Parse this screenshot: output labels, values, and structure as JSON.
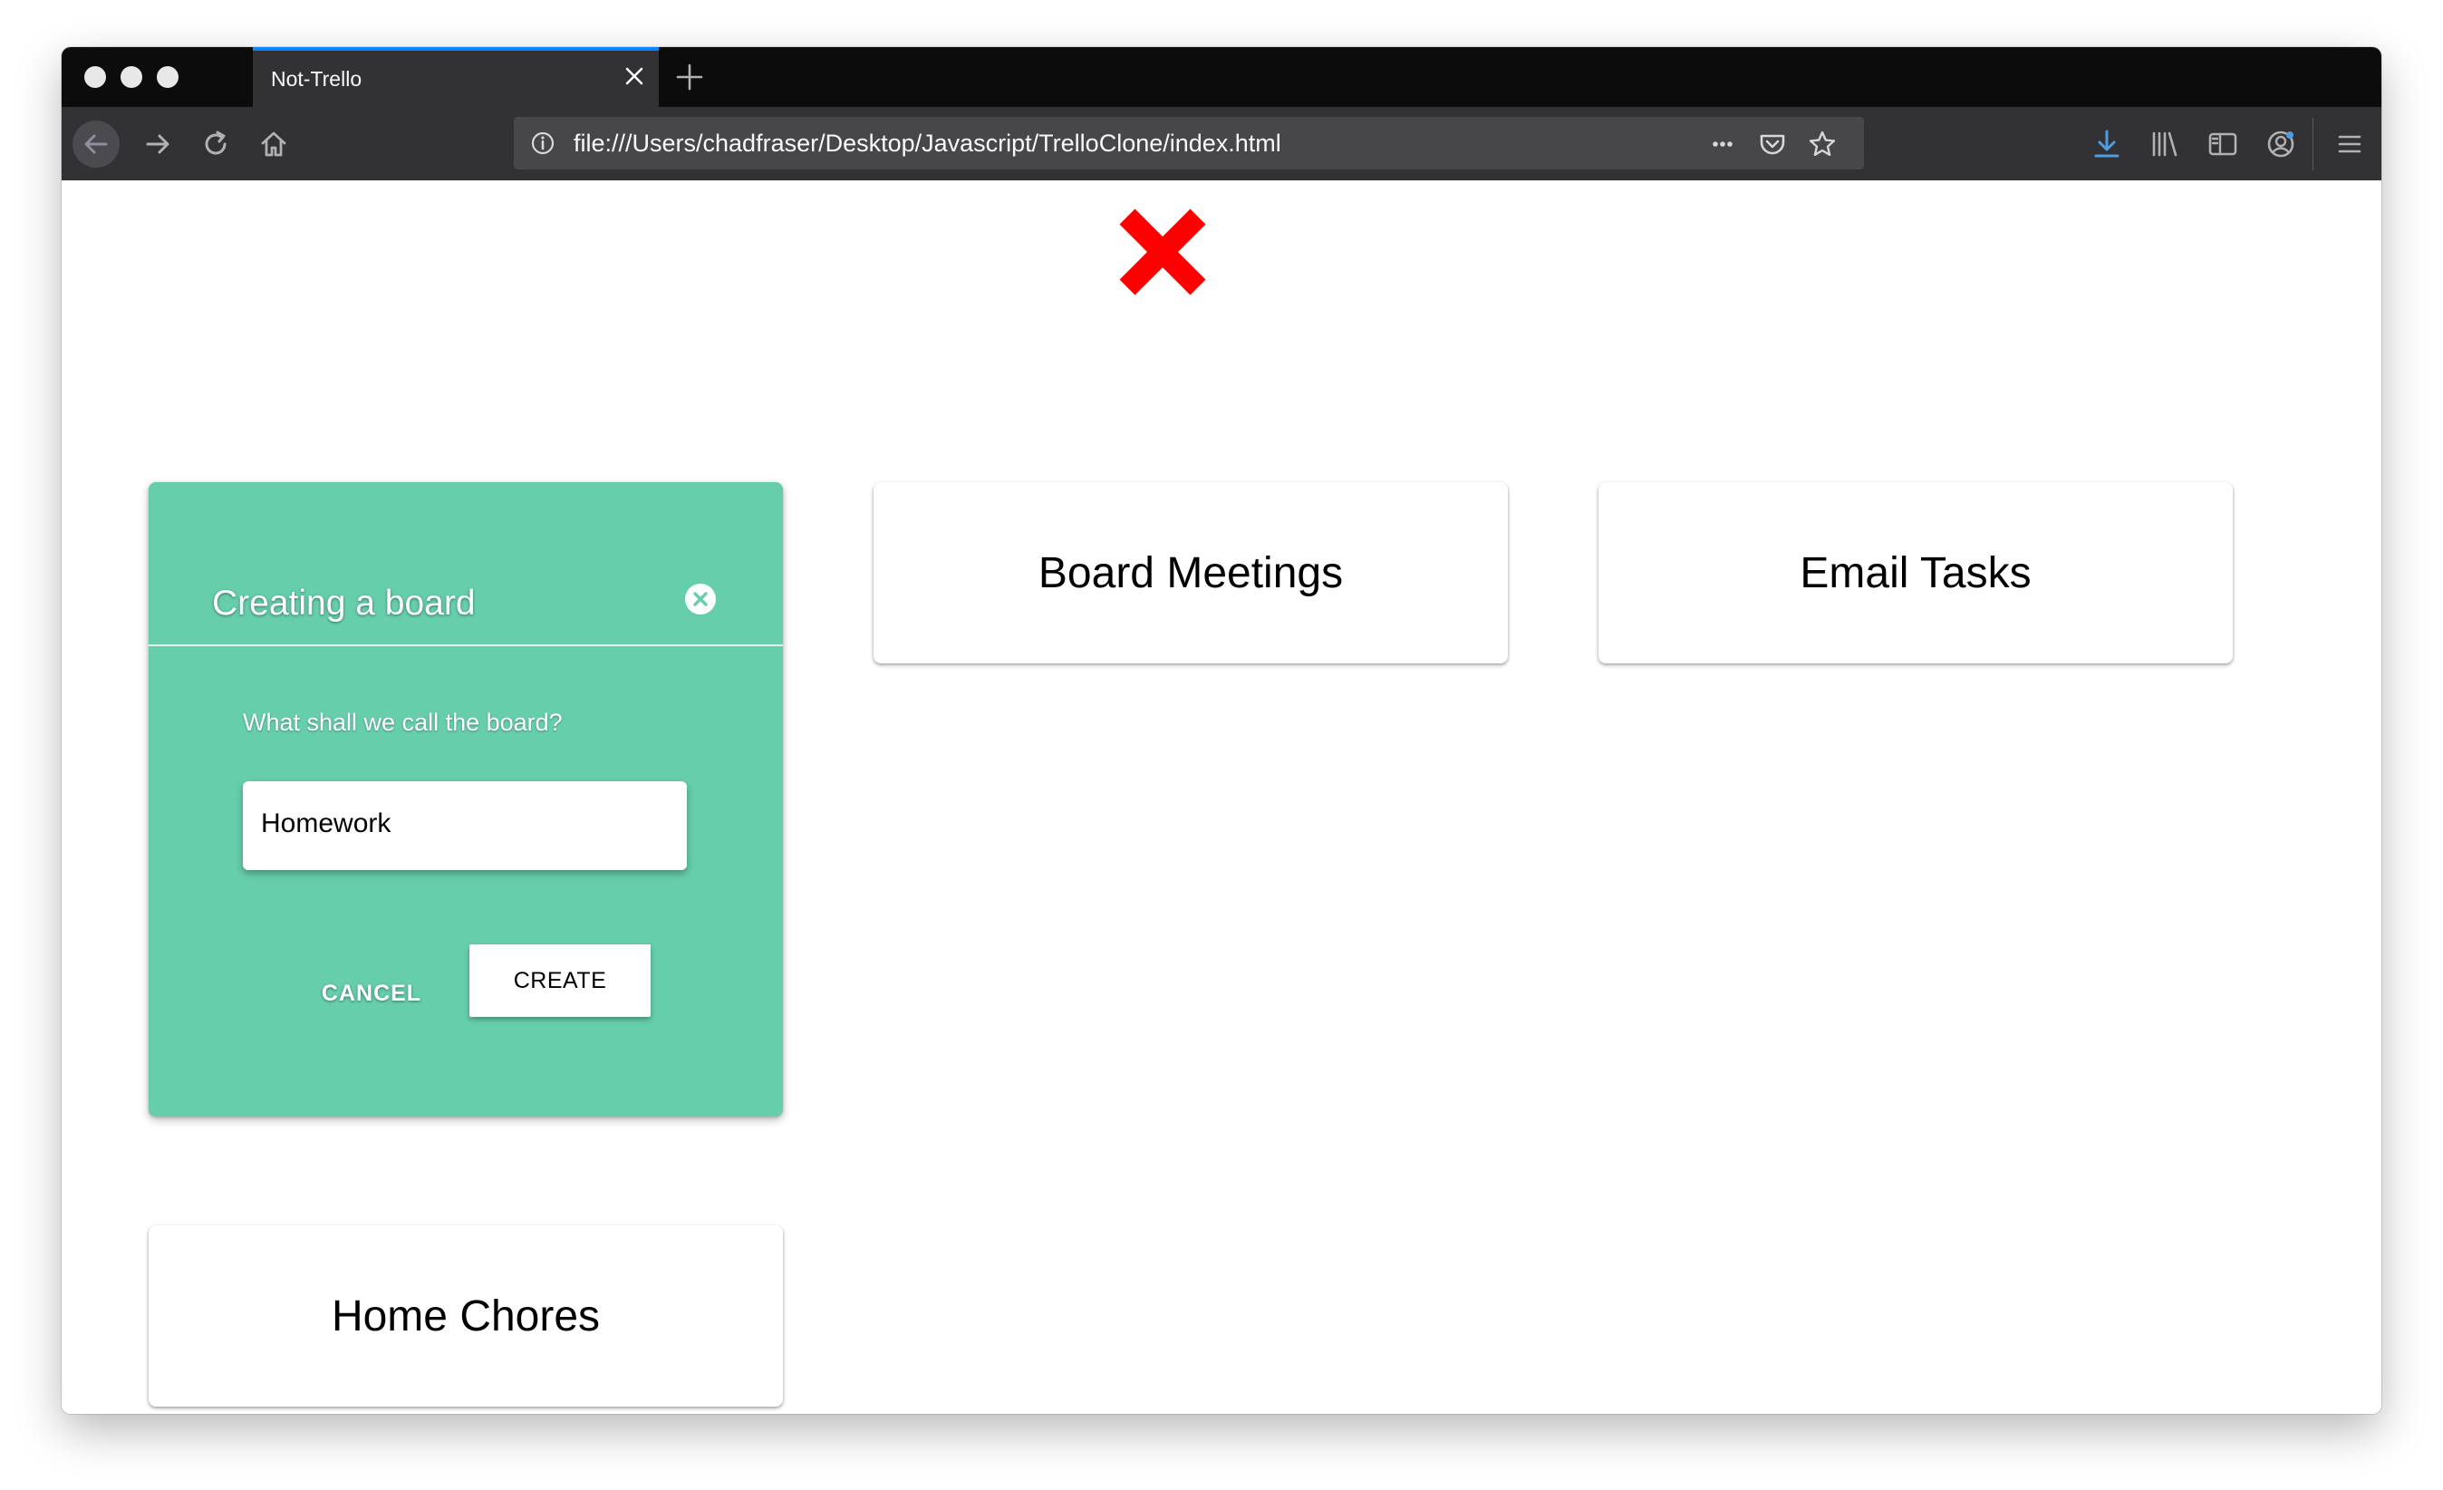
{
  "browser": {
    "tab_title": "Not-Trello",
    "url": "file:///Users/chadfraser/Desktop/Javascript/TrelloClone/index.html",
    "icons": {
      "back": "back-arrow-icon",
      "forward": "forward-arrow-icon",
      "reload": "reload-icon",
      "home": "home-icon",
      "site_info": "info-icon",
      "page_actions": "more-horizontal-icon",
      "pocket": "pocket-icon",
      "bookmark": "star-icon",
      "downloads": "download-icon",
      "library": "library-icon",
      "sidebar": "sidebar-icon",
      "account": "account-icon",
      "menu": "hamburger-menu-icon"
    },
    "colors": {
      "tab_accent": "#0a84ff",
      "download_accent": "#4d9de0"
    }
  },
  "page": {
    "logo_icon": "red-x-icon",
    "logo_color": "#ff0000",
    "boards": [
      {
        "name": "Board Meetings"
      },
      {
        "name": "Email Tasks"
      },
      {
        "name": "Home Chores"
      }
    ]
  },
  "dialog": {
    "title": "Creating a board",
    "close_icon": "close-circle-icon",
    "prompt": "What shall we call the board?",
    "input_value": "Homework",
    "cancel_label": "CANCEL",
    "create_label": "CREATE",
    "background_color": "#66ceaa"
  }
}
